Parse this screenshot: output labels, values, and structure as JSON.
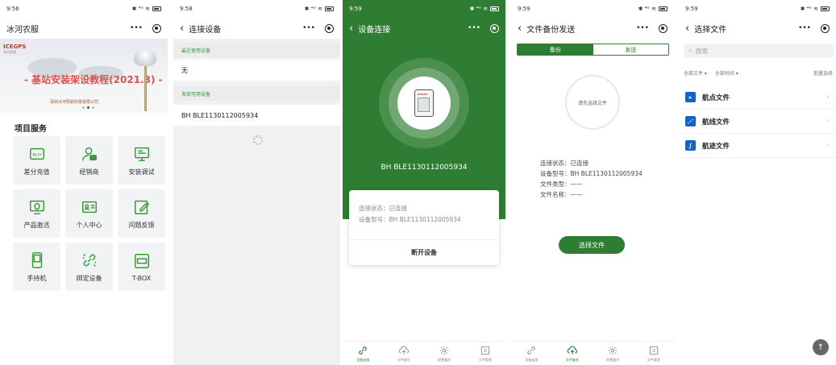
{
  "status_bar": {
    "times": [
      "9:56",
      "9:58",
      "9:59",
      "9:59",
      "9:59"
    ],
    "right": "✱ ⁴ᴳ ≋"
  },
  "screens": {
    "home": {
      "title": "冰河农服",
      "menu": "•••",
      "banner": {
        "logo": "ICEGPS",
        "logo_small": "冰河农服",
        "title": "- 基站安装架设教程(2021.3) -",
        "subtitle": "深圳冰河导航科技有限公司"
      },
      "section_title": "项目服务",
      "services": [
        {
          "label": "差分充值",
          "icon": "buy-icon"
        },
        {
          "label": "经销商",
          "icon": "dealer-icon"
        },
        {
          "label": "安装调试",
          "icon": "install-debug-icon"
        },
        {
          "label": "产品激活",
          "icon": "product-activate-icon"
        },
        {
          "label": "个人中心",
          "icon": "profile-card-icon"
        },
        {
          "label": "问题反馈",
          "icon": "feedback-edit-icon"
        },
        {
          "label": "手持机",
          "icon": "handheld-icon"
        },
        {
          "label": "绑定设备",
          "icon": "link-device-icon"
        },
        {
          "label": "T-BOX",
          "icon": "tbox-icon"
        }
      ]
    },
    "connect": {
      "title": "连接设备",
      "recent_label": "最近使用设备",
      "recent_value": "无",
      "available_label": "发现可用设备",
      "device": "BH BLE1130112005934"
    },
    "device": {
      "title": "设备连接",
      "device_name": "BH BLE1130112005934",
      "device_logo": "ICEGPS",
      "status_line": "连接状态：已连接",
      "model_line": "设备型号：BH BLE1130112005934",
      "disconnect_label": "断开设备"
    },
    "backup": {
      "title": "文件备份发送",
      "seg_backup": "备份",
      "seg_send": "发送",
      "circle_text": "请先选择文件",
      "info": [
        "连接状态：已连接",
        "设备型号：BH BLE1130112005934",
        "文件类型：——",
        "文件名称：——"
      ],
      "select_label": "选择文件"
    },
    "files": {
      "title": "选择文件",
      "search_placeholder": "搜索",
      "filter_all": "全部文件 ▾",
      "filter_time": "全部时间 ▾",
      "batch": "批量选择",
      "items": [
        {
          "label": "航点文件",
          "icon": "waypoint-file-icon"
        },
        {
          "label": "航线文件",
          "icon": "route-file-icon"
        },
        {
          "label": "航迹文件",
          "icon": "track-file-icon"
        }
      ]
    }
  },
  "tabbar": [
    {
      "label": "设备连接",
      "icon": "link-icon"
    },
    {
      "label": "文件备份",
      "icon": "cloud-upload-icon"
    },
    {
      "label": "配置备份",
      "icon": "config-gear-icon"
    },
    {
      "label": "文件管理",
      "icon": "file-manage-icon"
    }
  ],
  "colors": {
    "accent": "#2e7d32",
    "banner_title": "#d9534f",
    "file_icon": "#1565c0"
  }
}
